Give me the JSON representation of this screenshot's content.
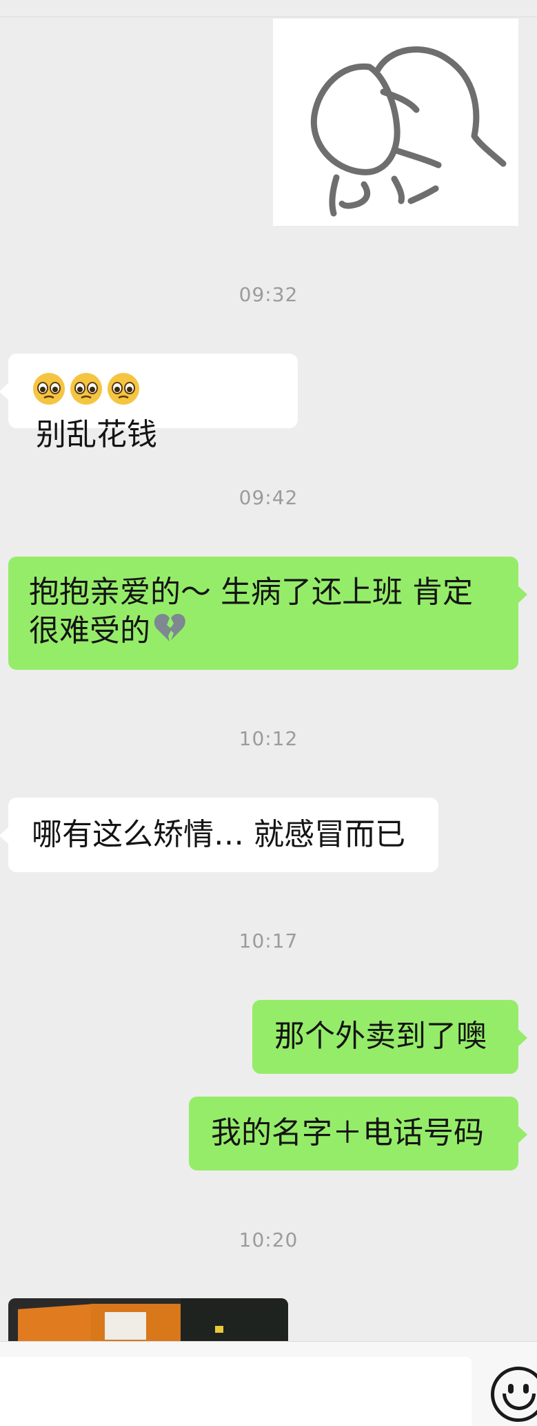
{
  "chat": {
    "timestamps": [
      "09:32",
      "09:42",
      "10:12",
      "10:17",
      "10:20"
    ],
    "messages": [
      {
        "side": "received",
        "type": "sticker",
        "description": "line drawing sticker"
      },
      {
        "side": "received",
        "text": "别乱花钱",
        "leading_emoji": [
          "pleading-face",
          "pleading-face",
          "pleading-face"
        ]
      },
      {
        "side": "sent",
        "line1": "抱抱亲爱的～ 生病了还上班 肯定",
        "line2": "很难受的",
        "trailing_emoji": "broken-heart"
      },
      {
        "side": "received",
        "text": "哪有这么矫情… 就感冒而已"
      },
      {
        "side": "sent",
        "text": "那个外卖到了噢"
      },
      {
        "side": "sent",
        "text": "我的名字＋电话号码"
      },
      {
        "side": "received",
        "type": "photo"
      }
    ]
  },
  "colors": {
    "background": "#ededed",
    "sent_bubble": "#95ec69",
    "received_bubble": "#ffffff",
    "timestamp": "#9b9b9b"
  },
  "input_bar": {
    "emoji_button_icon": "smiley-face-icon"
  }
}
